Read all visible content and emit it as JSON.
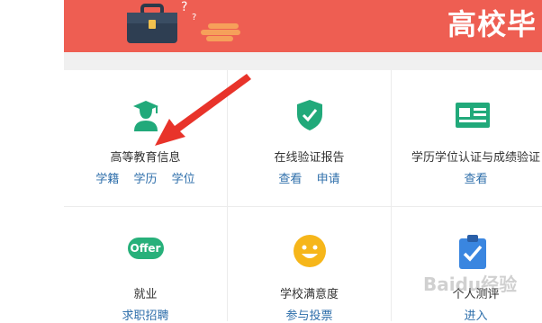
{
  "banner": {
    "title": "高校毕"
  },
  "services": [
    {
      "title": "高等教育信息",
      "links": [
        "学籍",
        "学历",
        "学位"
      ],
      "icon": "graduate-icon"
    },
    {
      "title": "在线验证报告",
      "links": [
        "查看",
        "申请"
      ],
      "icon": "shield-check-icon"
    },
    {
      "title": "学历学位认证与成绩验证",
      "links": [
        "查看"
      ],
      "icon": "id-card-icon"
    },
    {
      "title": "就业",
      "links": [
        "求职招聘"
      ],
      "icon": "offer-icon",
      "icon_text": "Offer"
    },
    {
      "title": "学校满意度",
      "links": [
        "参与投票"
      ],
      "icon": "smiley-icon"
    },
    {
      "title": "个人测评",
      "links": [
        "进入"
      ],
      "icon": "clipboard-check-icon"
    }
  ],
  "watermark": "Baidu经验",
  "colors": {
    "banner": "#ee5e52",
    "green": "#21a97a",
    "link": "#2f6fab",
    "arrow": "#e8332a",
    "offer": "#27b07a",
    "smiley": "#f6b61a",
    "clipboard": "#3a86e0"
  }
}
